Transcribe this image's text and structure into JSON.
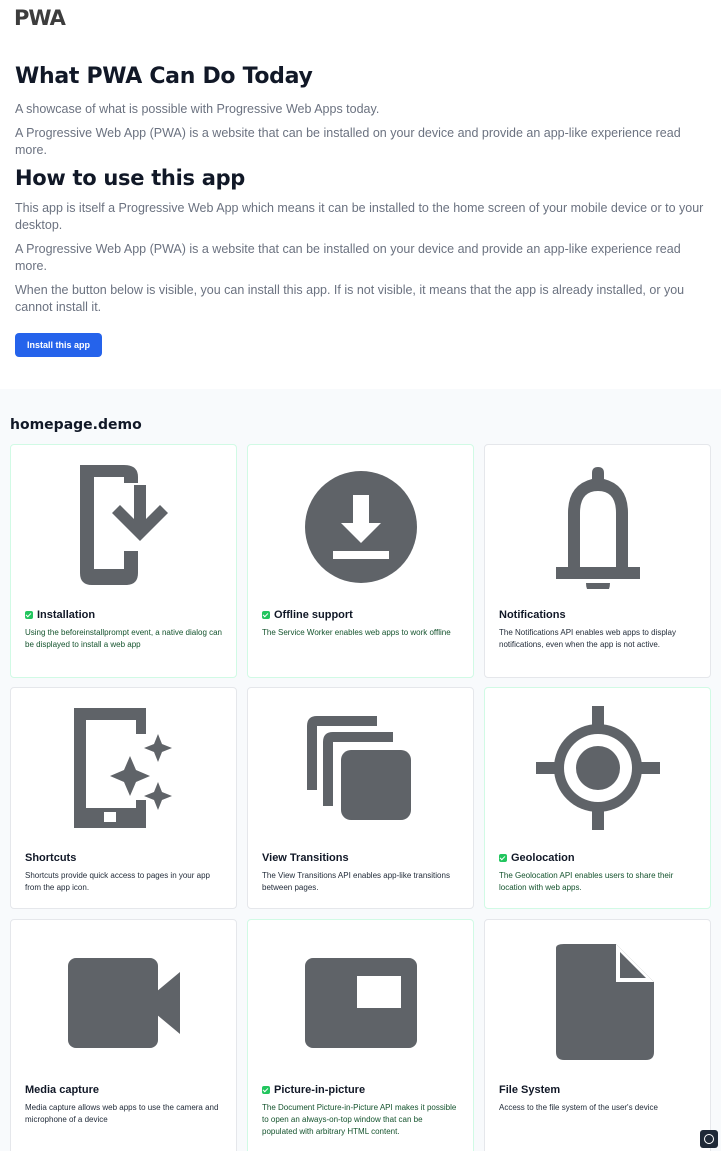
{
  "header": {
    "logo_text": "PWA"
  },
  "intro": {
    "heading": "What PWA Can Do Today",
    "paragraph_1": "A showcase of what is possible with Progressive Web Apps today.",
    "paragraph_2": "A Progressive Web App (PWA) is a website that can be installed on your device and provide an app-like experience read more.",
    "heading_2": "How to use this app",
    "paragraph_3": "This app is itself a Progressive Web App which means it can be installed to the home screen of your mobile device or to your desktop.",
    "paragraph_4": "A Progressive Web App (PWA) is a website that can be installed on your device and provide an app-like experience read more.",
    "paragraph_5": "When the button below is visible, you can install this app. If is not visible, it means that the app is already installed, or you cannot install it.",
    "install_button": "Install this app"
  },
  "showcase": {
    "title": "homepage.demo",
    "cards": [
      {
        "icon": "install-mobile-icon",
        "title": "Installation",
        "supported": true,
        "desc": "Using the beforeinstallprompt event, a native dialog can be displayed to install a web app"
      },
      {
        "icon": "download-circle-icon",
        "title": "Offline support",
        "supported": true,
        "desc": "The Service Worker enables web apps to work offline"
      },
      {
        "icon": "bell-icon",
        "title": "Notifications",
        "supported": false,
        "desc": "The Notifications API enables web apps to display notifications, even when the app is not active."
      },
      {
        "icon": "tablet-sparkle-icon",
        "title": "Shortcuts",
        "supported": false,
        "desc": "Shortcuts provide quick access to pages in your app from the app icon."
      },
      {
        "icon": "stacked-squares-icon",
        "title": "View Transitions",
        "supported": false,
        "desc": "The View Transitions API enables app-like transitions between pages."
      },
      {
        "icon": "crosshair-icon",
        "title": "Geolocation",
        "supported": true,
        "desc": "The Geolocation API enables users to share their location with web apps."
      },
      {
        "icon": "video-camera-icon",
        "title": "Media capture",
        "supported": false,
        "desc": "Media capture allows web apps to use the camera and microphone of a device"
      },
      {
        "icon": "picture-in-picture-icon",
        "title": "Picture-in-picture",
        "supported": true,
        "desc": "The Document Picture-in-Picture API makes it possible to open an always-on-top window that can be populated with arbitrary HTML content."
      },
      {
        "icon": "file-icon",
        "title": "File System",
        "supported": false,
        "desc": "Access to the file system of the user's device"
      }
    ]
  },
  "colors": {
    "accent": "#2563eb",
    "icon_gray": "#5f6368",
    "supported_green": "#22c55e"
  }
}
